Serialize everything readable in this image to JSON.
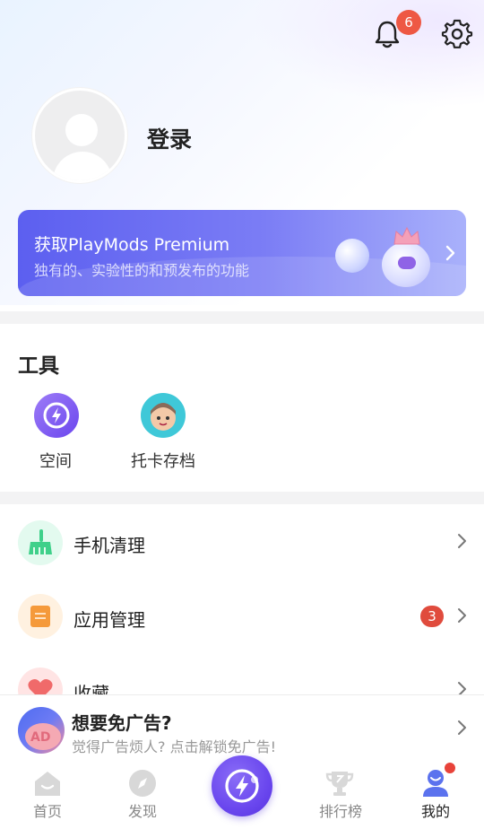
{
  "header": {
    "notification_count": "6",
    "login_label": "登录"
  },
  "premium": {
    "title": "获取PlayMods Premium",
    "subtitle": "独有的、实验性的和预发布的功能"
  },
  "tools": {
    "title": "工具",
    "items": [
      {
        "label": "空间",
        "icon": "space-icon"
      },
      {
        "label": "托卡存档",
        "icon": "toca-save-icon"
      }
    ]
  },
  "menu": {
    "items": [
      {
        "label": "手机清理",
        "icon": "broom-icon",
        "color": "#3fd08a"
      },
      {
        "label": "应用管理",
        "icon": "app-manage-icon",
        "color": "#f59a3b",
        "badge": "3"
      },
      {
        "label": "收藏",
        "icon": "heart-icon",
        "color": "#f06a6a"
      }
    ]
  },
  "ad": {
    "title": "想要免广告?",
    "subtitle": "觉得广告烦人? 点击解锁免广告!",
    "icon_text": "AD"
  },
  "tabs": [
    {
      "label": "首页",
      "icon": "home-icon"
    },
    {
      "label": "发现",
      "icon": "compass-icon"
    },
    {
      "label": "",
      "icon": "playmods-center-icon"
    },
    {
      "label": "排行榜",
      "icon": "trophy-icon"
    },
    {
      "label": "我的",
      "icon": "profile-icon",
      "active": true
    }
  ],
  "colors": {
    "accent": "#6a47ee",
    "badge_red": "#e04b3d"
  }
}
